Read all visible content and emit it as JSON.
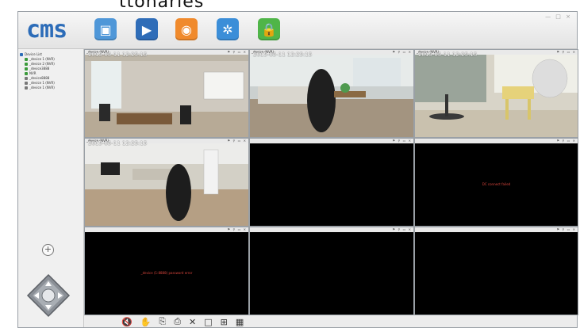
{
  "top_fragment": "ttonaries",
  "header": {
    "logo": "cms",
    "toolbar": [
      {
        "name": "monitor-button",
        "icon": "monitor-icon",
        "color": "#4f97d8",
        "glyph": "▣"
      },
      {
        "name": "playback-button",
        "icon": "clapperboard-icon",
        "color": "#2f6db8",
        "glyph": "▶"
      },
      {
        "name": "record-button",
        "icon": "record-icon",
        "color": "#f08a2c",
        "glyph": "◉"
      },
      {
        "name": "settings-button",
        "icon": "gear-icon",
        "color": "#3b8ed8",
        "glyph": "✲"
      },
      {
        "name": "lock-button",
        "icon": "lock-icon",
        "color": "#4fb548",
        "glyph": "🔒"
      }
    ],
    "window_controls": "— □ ×"
  },
  "sidebar": {
    "root": "Device List",
    "devices": [
      "_device 1 (NVR)",
      "_device 2 (NVR)",
      "_device3888",
      "NVR",
      "_device8888",
      "_device 1 (NVR)",
      "_device 1 (NVR)"
    ],
    "add_symbol": "+"
  },
  "cells": [
    {
      "title": "_device (NVR)",
      "timestamp": "2015-05-11 12:25:15",
      "status": "",
      "video": true
    },
    {
      "title": "_device (NVR)",
      "timestamp": "2015-05-11 12:25:15",
      "status": "",
      "video": true
    },
    {
      "title": "_device (NVR)",
      "timestamp": "2015-05-11 12:25:15",
      "status": "",
      "video": true
    },
    {
      "title": "_device (NVR)",
      "timestamp": "2015-05-11 12:25:15",
      "status": "",
      "video": true
    },
    {
      "title": "",
      "timestamp": "",
      "status": "",
      "video": false
    },
    {
      "title": "",
      "timestamp": "",
      "status": "DC connect failed",
      "video": false
    },
    {
      "title": "",
      "timestamp": "",
      "status": "_device (1:8888) password error",
      "video": false
    },
    {
      "title": "",
      "timestamp": "",
      "status": "",
      "video": false
    },
    {
      "title": "",
      "timestamp": "",
      "status": "",
      "video": false
    }
  ],
  "bottom_controls": [
    "mute-icon",
    "hand-icon",
    "capture-icon",
    "record-clip-icon",
    "fullscreen-icon",
    "layout-1-icon",
    "layout-4-icon",
    "layout-9-icon"
  ],
  "colors": {
    "accent": "#2c6cb8",
    "error": "#d9453c"
  }
}
